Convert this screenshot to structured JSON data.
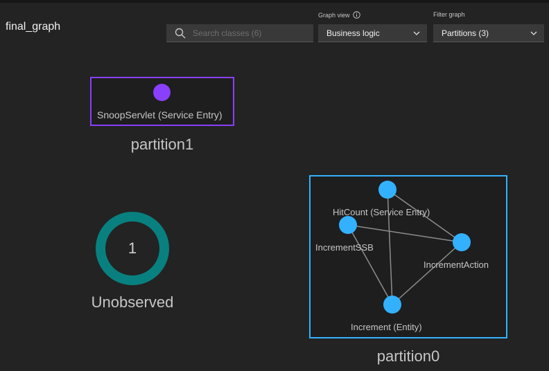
{
  "header": {
    "title": "final_graph",
    "search": {
      "placeholder": "Search classes (6)",
      "value": ""
    },
    "graph_view": {
      "label": "Graph view",
      "selected": "Business logic"
    },
    "filter_graph": {
      "label": "Filter graph",
      "selected": "Partitions (3)"
    }
  },
  "partitions": [
    {
      "name": "partition1",
      "color": "#8a3ffc",
      "nodes": [
        {
          "label": "SnoopServlet (Service Entry)"
        }
      ]
    },
    {
      "name": "partition0",
      "color": "#33b1ff",
      "nodes": [
        {
          "label": "HitCount (Service Entry)"
        },
        {
          "label": "IncrementSSB"
        },
        {
          "label": "IncrementAction"
        },
        {
          "label": "Increment (Entity)"
        }
      ]
    }
  ],
  "unobserved": {
    "count": "1",
    "label": "Unobserved",
    "color": "#08807f"
  }
}
